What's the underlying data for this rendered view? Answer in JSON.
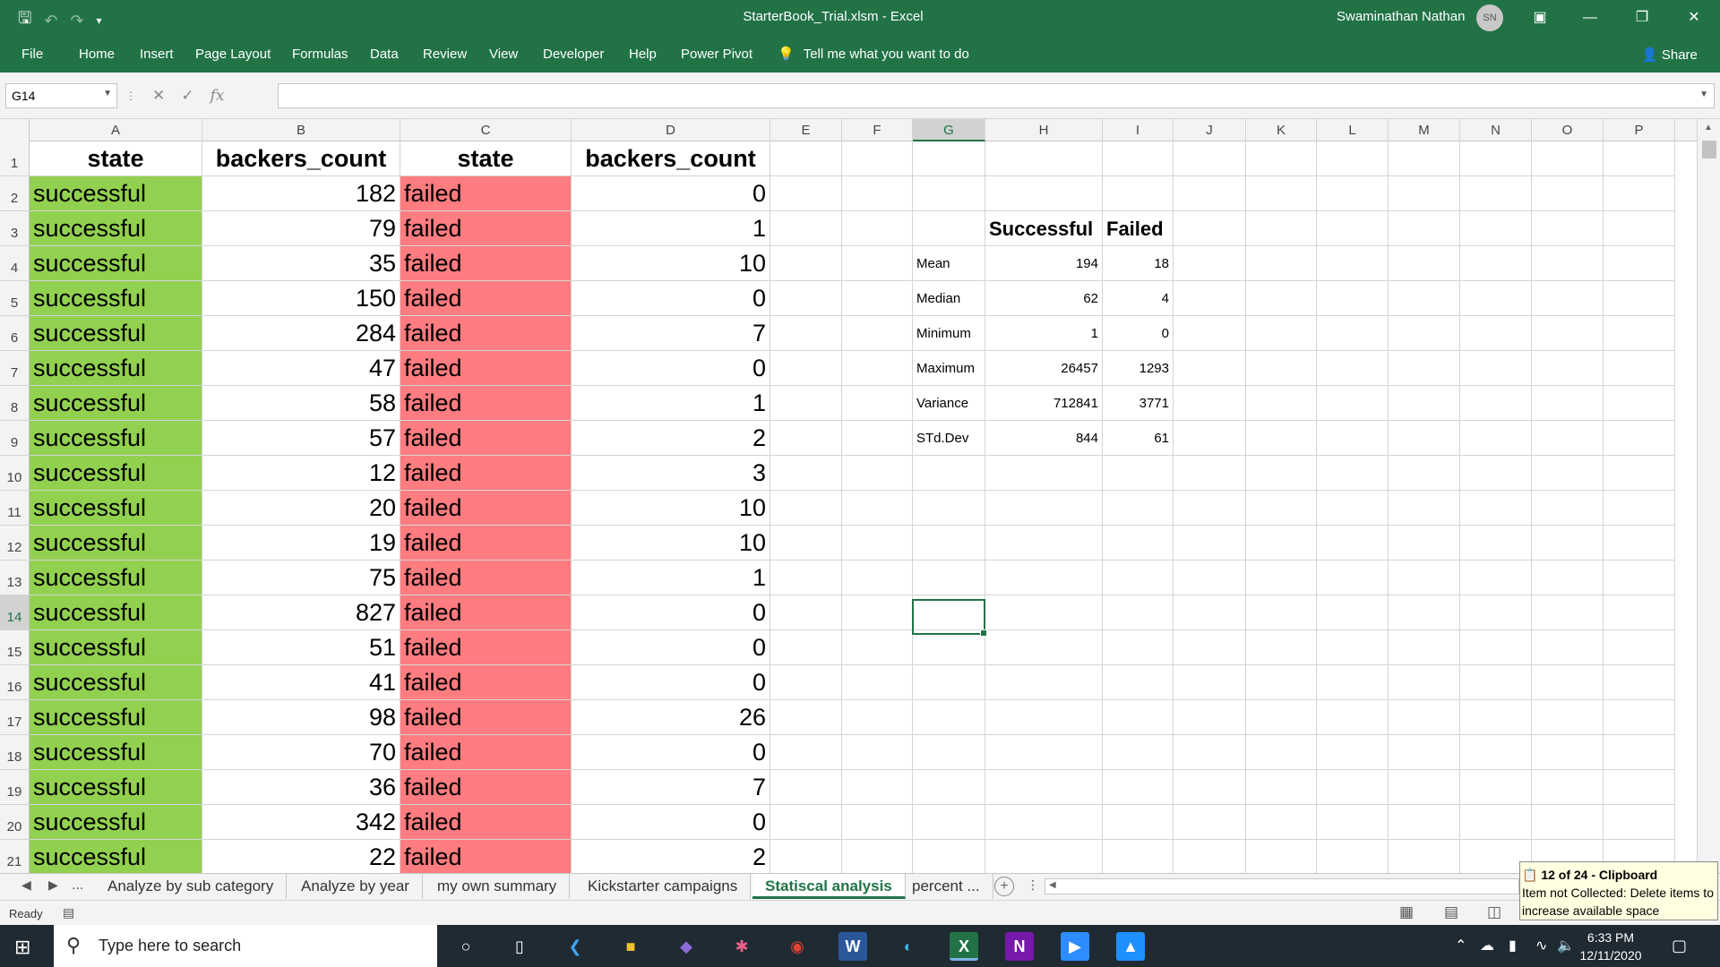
{
  "window": {
    "title": "StarterBook_Trial.xlsm  -  Excel",
    "user": "Swaminathan Nathan",
    "avatar_initials": "SN"
  },
  "qat": {
    "save": "save-icon",
    "undo": "undo-icon",
    "redo": "redo-icon",
    "customize": "customize-icon"
  },
  "ribbon": {
    "tabs": [
      "File",
      "Home",
      "Insert",
      "Page Layout",
      "Formulas",
      "Data",
      "Review",
      "View",
      "Developer",
      "Help",
      "Power Pivot"
    ],
    "tell_me": "Tell me what you want to do",
    "share": "Share"
  },
  "formula_bar": {
    "name_box": "G14",
    "formula": ""
  },
  "columns": [
    "A",
    "B",
    "C",
    "D",
    "E",
    "F",
    "G",
    "H",
    "I",
    "J",
    "K",
    "L",
    "M",
    "N",
    "O",
    "P"
  ],
  "selected_column": "G",
  "selected_row": "14",
  "sheet": {
    "headers": [
      "state",
      "backers_count",
      "state",
      "backers_count"
    ],
    "rows": [
      {
        "n": "2",
        "a": "successful",
        "b": "182",
        "c": "failed",
        "d": "0"
      },
      {
        "n": "3",
        "a": "successful",
        "b": "79",
        "c": "failed",
        "d": "1"
      },
      {
        "n": "4",
        "a": "successful",
        "b": "35",
        "c": "failed",
        "d": "10"
      },
      {
        "n": "5",
        "a": "successful",
        "b": "150",
        "c": "failed",
        "d": "0"
      },
      {
        "n": "6",
        "a": "successful",
        "b": "284",
        "c": "failed",
        "d": "7"
      },
      {
        "n": "7",
        "a": "successful",
        "b": "47",
        "c": "failed",
        "d": "0"
      },
      {
        "n": "8",
        "a": "successful",
        "b": "58",
        "c": "failed",
        "d": "1"
      },
      {
        "n": "9",
        "a": "successful",
        "b": "57",
        "c": "failed",
        "d": "2"
      },
      {
        "n": "10",
        "a": "successful",
        "b": "12",
        "c": "failed",
        "d": "3"
      },
      {
        "n": "11",
        "a": "successful",
        "b": "20",
        "c": "failed",
        "d": "10"
      },
      {
        "n": "12",
        "a": "successful",
        "b": "19",
        "c": "failed",
        "d": "10"
      },
      {
        "n": "13",
        "a": "successful",
        "b": "75",
        "c": "failed",
        "d": "1"
      },
      {
        "n": "14",
        "a": "successful",
        "b": "827",
        "c": "failed",
        "d": "0"
      },
      {
        "n": "15",
        "a": "successful",
        "b": "51",
        "c": "failed",
        "d": "0"
      },
      {
        "n": "16",
        "a": "successful",
        "b": "41",
        "c": "failed",
        "d": "0"
      },
      {
        "n": "17",
        "a": "successful",
        "b": "98",
        "c": "failed",
        "d": "26"
      },
      {
        "n": "18",
        "a": "successful",
        "b": "70",
        "c": "failed",
        "d": "0"
      },
      {
        "n": "19",
        "a": "successful",
        "b": "36",
        "c": "failed",
        "d": "7"
      },
      {
        "n": "20",
        "a": "successful",
        "b": "342",
        "c": "failed",
        "d": "0"
      },
      {
        "n": "21",
        "a": "successful",
        "b": "22",
        "c": "failed",
        "d": "2"
      }
    ],
    "stats_headers": [
      "Successful",
      "Failed"
    ],
    "stats": [
      {
        "label": "Mean",
        "successful": "194",
        "failed": "18"
      },
      {
        "label": "Median",
        "successful": "62",
        "failed": "4"
      },
      {
        "label": "Minimum",
        "successful": "1",
        "failed": "0"
      },
      {
        "label": "Maximum",
        "successful": "26457",
        "failed": "1293"
      },
      {
        "label": "Variance",
        "successful": "712841",
        "failed": "3771"
      },
      {
        "label": "STd.Dev",
        "successful": "844",
        "failed": "61"
      }
    ]
  },
  "sheet_tabs": {
    "ellipsis": "...",
    "tabs": [
      "Analyze by sub category",
      "Analyze by year",
      "my own summary",
      "Kickstarter campaigns",
      "Statiscal analysis",
      "percent ..."
    ],
    "active": "Statiscal analysis"
  },
  "status": {
    "ready": "Ready"
  },
  "clipboard": {
    "title": "12 of 24 - Clipboard",
    "message": "Item not Collected: Delete items to increase available space"
  },
  "taskbar": {
    "search_placeholder": "Type here to search",
    "time": "6:33 PM",
    "date": "12/11/2020"
  },
  "colors": {
    "excel_green": "#217346",
    "successful_fill": "#92d050",
    "failed_fill": "#ff7c80"
  }
}
